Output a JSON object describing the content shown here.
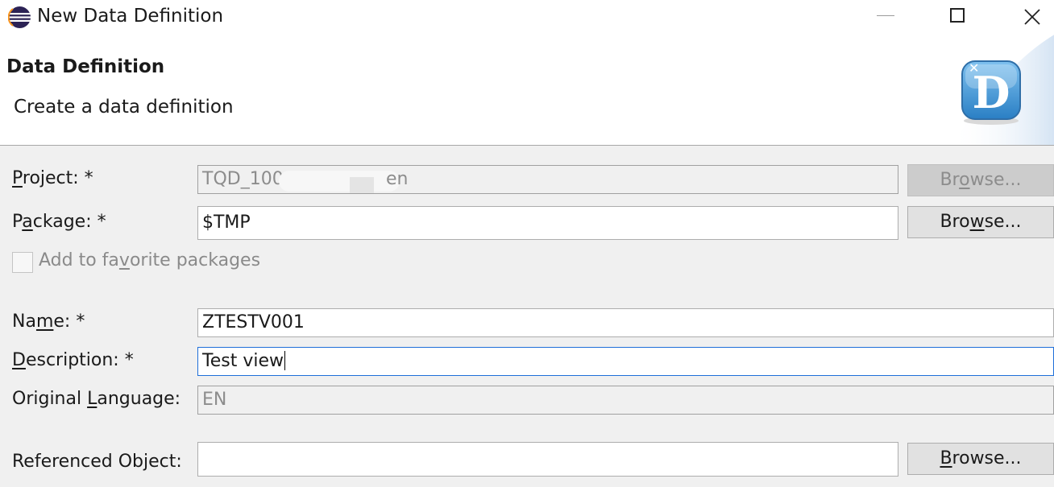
{
  "window": {
    "title": "New Data Definition"
  },
  "header": {
    "title": "Data Definition",
    "description": "Create a data definition",
    "icon_letter": "D",
    "icon": "data-definition-icon"
  },
  "form": {
    "project": {
      "label_pre": "",
      "label_key": "P",
      "label_post": "roject: *",
      "value": "TQD_100",
      "value_tail": "en",
      "browse": {
        "pre": "Br",
        "key": "o",
        "post": "wse..."
      }
    },
    "package": {
      "label_pre": "P",
      "label_key": "a",
      "label_post": "ckage: *",
      "value": "$TMP",
      "browse": {
        "pre": "Bro",
        "key": "w",
        "post": "se..."
      }
    },
    "favorite": {
      "pre": "Add to fa",
      "key": "v",
      "post": "orite packages",
      "checked": false
    },
    "name": {
      "label_pre": "Na",
      "label_key": "m",
      "label_post": "e: *",
      "value": "ZTESTV001"
    },
    "description": {
      "label_pre": "",
      "label_key": "D",
      "label_post": "escription: *",
      "value": "Test view"
    },
    "language": {
      "label_pre": "Original ",
      "label_key": "L",
      "label_post": "anguage:",
      "value": "EN"
    },
    "referenced": {
      "label": "Referenced Object:",
      "value": "",
      "browse": {
        "pre": "",
        "key": "B",
        "post": "rowse..."
      }
    }
  }
}
